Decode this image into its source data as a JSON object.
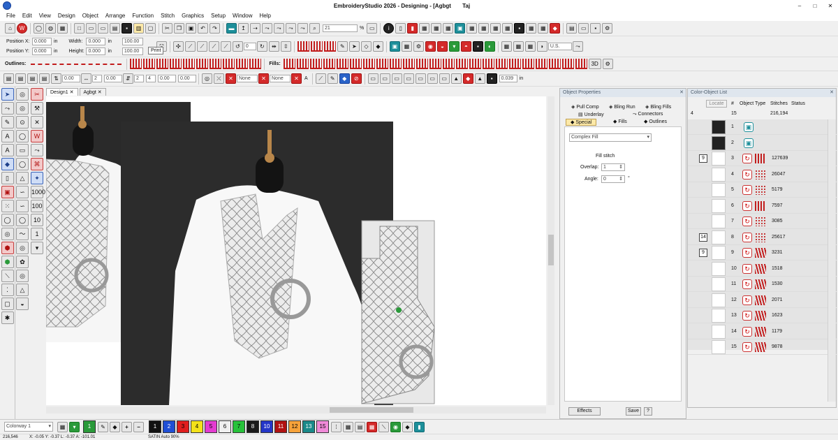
{
  "title_bar": {
    "title": "EmbroideryStudio 2026 - Designing - [Agbgt",
    "title_extra": "Taj"
  },
  "menu": [
    "File",
    "Edit",
    "View",
    "Design",
    "Object",
    "Arrange",
    "Function",
    "Stitch",
    "Graphics",
    "Setup",
    "Window",
    "Help"
  ],
  "toolbar_main": {
    "zoom_value": "21",
    "zoom_unit": "%",
    "tooltip": "Print"
  },
  "position_bar": {
    "pos_x_label": "Position X:",
    "pos_x": "0.000",
    "pos_x_unit": "in",
    "pos_y_label": "Position Y:",
    "pos_y": "0.000",
    "pos_y_unit": "in",
    "width_label": "Width:",
    "width": "0.000",
    "width_unit": "in",
    "width_pct": "100.00",
    "height_label": "Height:",
    "height": "0.000",
    "height_unit": "in",
    "height_pct": "100.00",
    "rotate_value": "0",
    "units_select": "U.S."
  },
  "outlines_bar": {
    "outlines_label": "Outlines:",
    "fills_label": "Fills:"
  },
  "props_bar": {
    "v1": "0.00",
    "v2": "2",
    "v3": "0.00",
    "v4": "2",
    "v5": "4",
    "v6": "0.00",
    "v7": "0.00",
    "none1": "None",
    "none2": "None",
    "a_label": "A",
    "width_value": "0.039",
    "width_unit": "in"
  },
  "doc_tabs": [
    "Design1",
    "Agbgt"
  ],
  "object_properties": {
    "title": "Object Properties",
    "tabs_row1": [
      "Pull Comp",
      "Bling Run",
      "Bling Fills"
    ],
    "tabs_row2": [
      "Underlay",
      "Connectors"
    ],
    "tabs_row3": [
      "Special",
      "Fills",
      "Outlines"
    ],
    "fill_type": "Complex Fill",
    "section_label": "Fill stitch",
    "overlap_label": "Overlap:",
    "overlap_value": "1",
    "angle_label": "Angle:",
    "angle_value": "0",
    "angle_unit": "°",
    "effects_button": "Effects",
    "save_button": "Save",
    "help_button": "?"
  },
  "color_object_list": {
    "title": "Color-Object List",
    "locate": "Locate",
    "headers": [
      "#",
      "Object Type",
      "Stitches",
      "Status"
    ],
    "summary": {
      "colors": "4",
      "objects": "15",
      "stitches": "216,194"
    },
    "rows": [
      {
        "num": "1",
        "stitches": "",
        "group": "",
        "kind": "image"
      },
      {
        "num": "2",
        "stitches": "",
        "group": "",
        "kind": "image"
      },
      {
        "num": "3",
        "stitches": "127639",
        "group": "9",
        "kind": "fill"
      },
      {
        "num": "4",
        "stitches": "26047",
        "group": "",
        "kind": "fill-dots"
      },
      {
        "num": "5",
        "stitches": "5179",
        "group": "",
        "kind": "fill-dots"
      },
      {
        "num": "6",
        "stitches": "7597",
        "group": "",
        "kind": "fill"
      },
      {
        "num": "7",
        "stitches": "3085",
        "group": "",
        "kind": "fill-dots"
      },
      {
        "num": "8",
        "stitches": "25617",
        "group": "14",
        "kind": "fill-dots"
      },
      {
        "num": "9",
        "stitches": "3231",
        "group": "9",
        "kind": "satin"
      },
      {
        "num": "10",
        "stitches": "1518",
        "group": "",
        "kind": "satin"
      },
      {
        "num": "11",
        "stitches": "1530",
        "group": "",
        "kind": "satin"
      },
      {
        "num": "12",
        "stitches": "2071",
        "group": "",
        "kind": "satin"
      },
      {
        "num": "13",
        "stitches": "1623",
        "group": "",
        "kind": "satin"
      },
      {
        "num": "14",
        "stitches": "1179",
        "group": "",
        "kind": "satin"
      },
      {
        "num": "15",
        "stitches": "9878",
        "group": "",
        "kind": "satin"
      }
    ]
  },
  "bottom_bar": {
    "colorway": "Colorway 1",
    "palette": [
      {
        "num": "1",
        "color": "#111111"
      },
      {
        "num": "2",
        "color": "#1f4fd6"
      },
      {
        "num": "3",
        "color": "#e01e1e"
      },
      {
        "num": "4",
        "color": "#f4e21a"
      },
      {
        "num": "5",
        "color": "#e43bd1"
      },
      {
        "num": "6",
        "color": "#f0f0f0"
      },
      {
        "num": "7",
        "color": "#27c23a"
      },
      {
        "num": "8",
        "color": "#1a1a1a"
      },
      {
        "num": "10",
        "color": "#2436c8"
      },
      {
        "num": "11",
        "color": "#b01212"
      },
      {
        "num": "12",
        "color": "#f6a23a"
      },
      {
        "num": "13",
        "color": "#1a8a8a"
      },
      {
        "num": "15",
        "color": "#f08ad8"
      }
    ],
    "current_color": "#2a9a3a",
    "current_label": "1"
  },
  "status_bar": {
    "stitches": "216,546",
    "x": "X: -0.05 Y: -0.37 L: -0.37 A: -101.01",
    "mode": "SATIN Auto 90%"
  }
}
